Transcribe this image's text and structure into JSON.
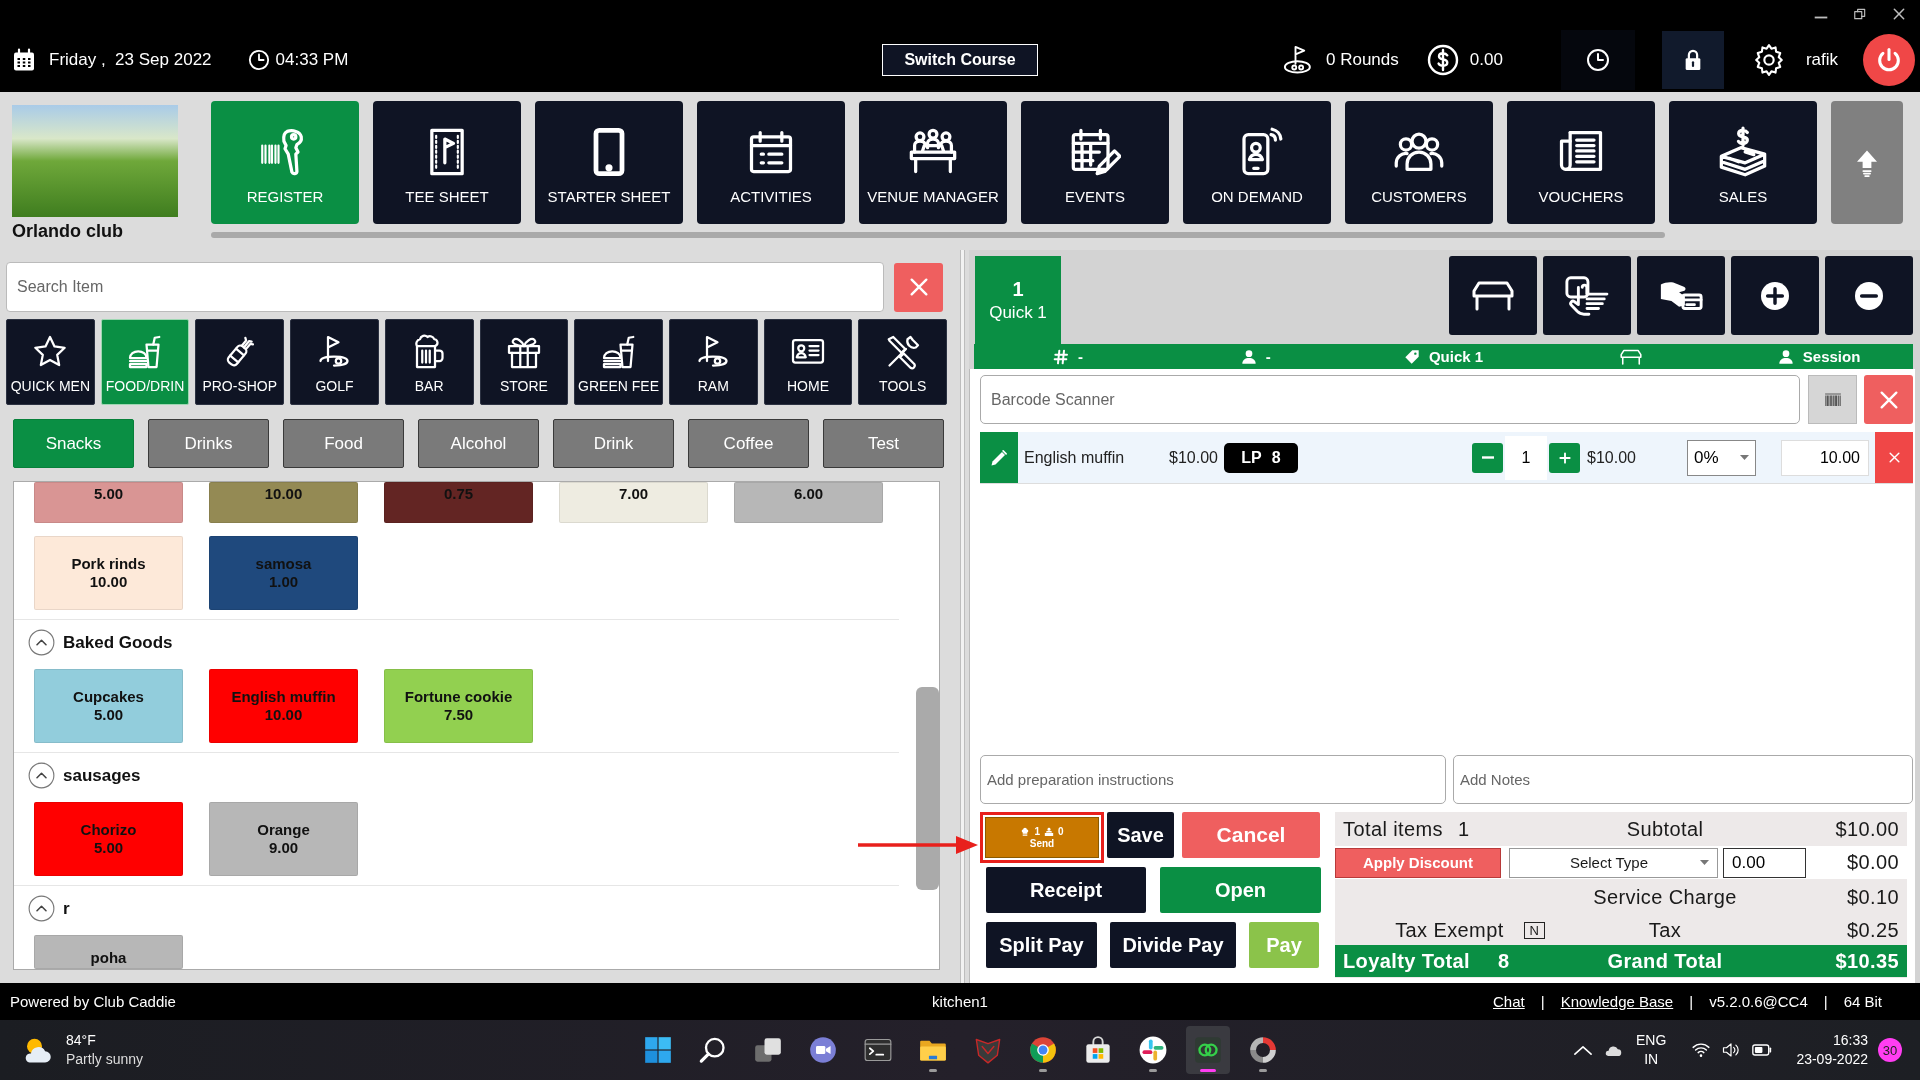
{
  "header": {
    "date": "Friday ,  23 Sep 2022",
    "time": "04:33 PM",
    "switch_button": "Switch Course",
    "rounds": "0 Rounds",
    "balance": "0.00",
    "user": "rafik"
  },
  "club": {
    "name": "Orlando club"
  },
  "nav": [
    {
      "label": "REGISTER",
      "selected": true
    },
    {
      "label": "TEE SHEET",
      "selected": false
    },
    {
      "label": "STARTER SHEET",
      "selected": false
    },
    {
      "label": "ACTIVITIES",
      "selected": false
    },
    {
      "label": "VENUE MANAGER",
      "selected": false
    },
    {
      "label": "EVENTS",
      "selected": false
    },
    {
      "label": "ON DEMAND",
      "selected": false
    },
    {
      "label": "CUSTOMERS",
      "selected": false
    },
    {
      "label": "VOUCHERS",
      "selected": false
    },
    {
      "label": "SALES",
      "selected": false
    }
  ],
  "search": {
    "placeholder": "Search Item"
  },
  "categories": [
    {
      "label": "QUICK MEN",
      "selected": false
    },
    {
      "label": "FOOD/DRIN",
      "selected": true
    },
    {
      "label": "PRO-SHOP",
      "selected": false
    },
    {
      "label": "GOLF",
      "selected": false
    },
    {
      "label": "BAR",
      "selected": false
    },
    {
      "label": "STORE",
      "selected": false
    },
    {
      "label": "GREEN FEE",
      "selected": false
    },
    {
      "label": "RAM",
      "selected": false
    },
    {
      "label": "HOME",
      "selected": false
    },
    {
      "label": "TOOLS",
      "selected": false
    }
  ],
  "subcategories": [
    {
      "label": "Snacks",
      "selected": true
    },
    {
      "label": "Drinks",
      "selected": false
    },
    {
      "label": "Food",
      "selected": false
    },
    {
      "label": "Alcohol",
      "selected": false
    },
    {
      "label": "Drink",
      "selected": false
    },
    {
      "label": "Coffee",
      "selected": false
    },
    {
      "label": "Test",
      "selected": false
    }
  ],
  "product_groups": [
    {
      "items": [
        {
          "price": "5.00",
          "color": "#d99594"
        },
        {
          "price": "10.00",
          "color": "#948a54"
        },
        {
          "price": "0.75",
          "color": "#632523"
        },
        {
          "price": "7.00",
          "color": "#eeece1"
        },
        {
          "price": "6.00",
          "color": "#b7b7b7"
        },
        {
          "name": "Pork rinds",
          "price": "10.00",
          "color": "#fde9d9"
        },
        {
          "name": "samosa",
          "price": "1.00",
          "color": "#1f497d"
        }
      ]
    },
    {
      "title": "Baked Goods",
      "expanded": true,
      "items": [
        {
          "name": "Cupcakes",
          "price": "5.00",
          "color": "#92cddc"
        },
        {
          "name": "English muffin",
          "price": "10.00",
          "color": "#ff0000"
        },
        {
          "name": "Fortune cookie",
          "price": "7.50",
          "color": "#92d050"
        }
      ]
    },
    {
      "title": "sausages",
      "expanded": true,
      "items": [
        {
          "name": "Chorizo",
          "price": "5.00",
          "color": "#ff0000"
        },
        {
          "name": "Orange",
          "price": "9.00",
          "color": "#b7b7b7"
        }
      ]
    },
    {
      "title": "r",
      "expanded": true,
      "items": [
        {
          "name": "poha",
          "color": "#b7b7b7"
        }
      ]
    }
  ],
  "order": {
    "tab": {
      "number": "1",
      "label": "Quick 1",
      "selected": true
    },
    "info": {
      "number": "-",
      "customer": "-",
      "tag": "Quick 1",
      "session": "Session"
    },
    "barcode": {
      "placeholder": "Barcode Scanner"
    },
    "lines": [
      {
        "name": "English muffin",
        "price": "$10.00",
        "loyalty": "LP 8",
        "quantity": "1",
        "total": "$10.00",
        "discount": "0%",
        "amount": "10.00"
      }
    ],
    "preparation": {
      "placeholder": "Add preparation instructions"
    },
    "notes": {
      "placeholder": "Add Notes"
    }
  },
  "send": {
    "cook_count": "1",
    "station_count": "0",
    "label": "Send",
    "highlighted": true
  },
  "buttons": {
    "save": "Save",
    "cancel": "Cancel",
    "receipt": "Receipt",
    "open": "Open",
    "split_pay": "Split Pay",
    "divide_pay": "Divide Pay",
    "pay": "Pay"
  },
  "totals": {
    "items_label": "Total items",
    "items_count": "1",
    "subtotal_label": "Subtotal",
    "subtotal": "$10.00",
    "discount_button": "Apply Discount",
    "discount_type": "Select Type",
    "discount_value": "0.00",
    "discount": "$0.00",
    "service_label": "Service Charge",
    "service": "$0.10",
    "tax_exempt_label": "Tax Exempt",
    "tax_exempt_flag": "N",
    "tax_label": "Tax",
    "tax": "$0.25",
    "loyalty_label": "Loyalty Total",
    "loyalty": "8",
    "grand_label": "Grand Total",
    "grand_total": "$10.35"
  },
  "status_bar": {
    "powered_by": "Powered by Club Caddie",
    "station": "kitchen1",
    "items": [
      {
        "text": "Chat",
        "kind": "link"
      },
      {
        "text": "|",
        "kind": "separator"
      },
      {
        "text": "Knowledge Base",
        "kind": "link"
      },
      {
        "text": "|",
        "kind": "separator"
      },
      {
        "text": "v5.2.0.6@CC4",
        "kind": "text"
      },
      {
        "text": "|",
        "kind": "separator"
      },
      {
        "text": "64 Bit",
        "kind": "text"
      }
    ]
  },
  "taskbar": {
    "weather": {
      "temperature": "84°F",
      "condition": "Partly sunny"
    },
    "apps": [
      {
        "running": false,
        "selected": false
      },
      {
        "running": false,
        "selected": false
      },
      {
        "running": false,
        "selected": false
      },
      {
        "running": false,
        "selected": false
      },
      {
        "running": false,
        "selected": false
      },
      {
        "running": true,
        "selected": false
      },
      {
        "running": false,
        "selected": false
      },
      {
        "running": true,
        "selected": false
      },
      {
        "running": false,
        "selected": false
      },
      {
        "running": true,
        "selected": false
      },
      {
        "running": true,
        "selected": true
      },
      {
        "running": true,
        "selected": false
      }
    ],
    "language": {
      "input": "ENG",
      "region": "IN"
    },
    "clock": {
      "time": "16:33",
      "date": "23-09-2022"
    },
    "notifications": "30"
  }
}
